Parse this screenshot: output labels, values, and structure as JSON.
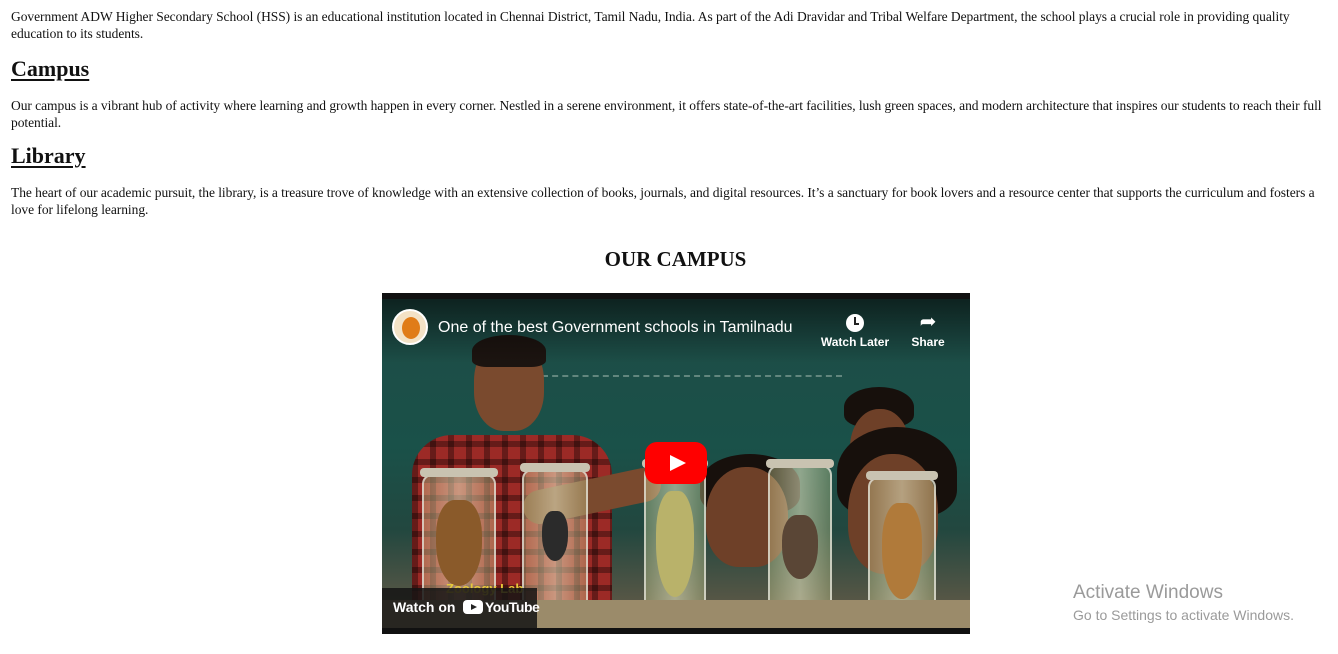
{
  "intro": {
    "text": "Government ADW Higher Secondary School (HSS) is an educational institution located in Chennai District, Tamil Nadu, India. As part of the Adi Dravidar and Tribal Welfare Department, the school plays a crucial role in providing quality education to its students."
  },
  "campus": {
    "heading": "Campus",
    "text": "Our campus is a vibrant hub of activity where learning and growth happen in every corner. Nestled in a serene environment, it offers state-of-the-art facilities, lush green spaces, and modern architecture that inspires our students to reach their full potential."
  },
  "library": {
    "heading": "Library",
    "text": "The heart of our academic pursuit, the library, is a treasure trove of knowledge with an extensive collection of books, journals, and digital resources. It’s a sanctuary for book lovers and a resource center that supports the curriculum and fosters a love for lifelong learning."
  },
  "video_section": {
    "heading": "OUR CAMPUS"
  },
  "video": {
    "title": "One of the best Government schools in Tamilnadu",
    "watch_later_label": "Watch Later",
    "share_label": "Share",
    "watch_on_label": "Watch on",
    "youtube_label": "YouTube",
    "thumbnail_caption": "Zoology Lab",
    "icons": {
      "channel": "channel-avatar",
      "watch_later": "clock-icon",
      "share": "share-arrow-icon",
      "play": "play-icon",
      "logo": "youtube-logo-icon"
    },
    "colors": {
      "play_button": "#ff0000",
      "bar": "#111111"
    }
  },
  "watermark": {
    "line1": "Activate Windows",
    "line2": "Go to Settings to activate Windows."
  }
}
